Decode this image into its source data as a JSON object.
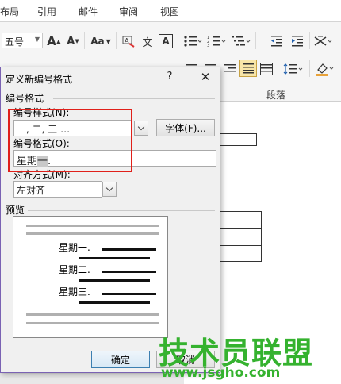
{
  "ribbon": {
    "tabs": [
      "布局",
      "引用",
      "邮件",
      "审阅",
      "视图"
    ],
    "font_size": "五号",
    "font_grow_label": "A",
    "font_shrink_label": "A",
    "change_case_label": "Aa",
    "phonetic_label": "文",
    "char_border_label": "A",
    "group_paragraph_label": "段落"
  },
  "dialog": {
    "title": "定义新编号格式",
    "help_label": "?",
    "close_label": "✕",
    "section_number_format": "编号格式",
    "number_style_label": "编号样式(N):",
    "number_style_value": "一, 二, 三 …",
    "font_button_label": "字体(F)...",
    "number_format_label": "编号格式(O):",
    "number_format_prefix": "星期",
    "number_format_field_code": "一",
    "number_format_suffix": ".",
    "alignment_label": "对齐方式(M):",
    "alignment_value": "左对齐",
    "preview_label": "预览",
    "preview_items": [
      "星期一.",
      "星期二.",
      "星期三."
    ],
    "ok_label": "确定",
    "cancel_label": "取消"
  },
  "watermark": {
    "main": "技术员联盟",
    "sub": "www.jsgho.com"
  }
}
